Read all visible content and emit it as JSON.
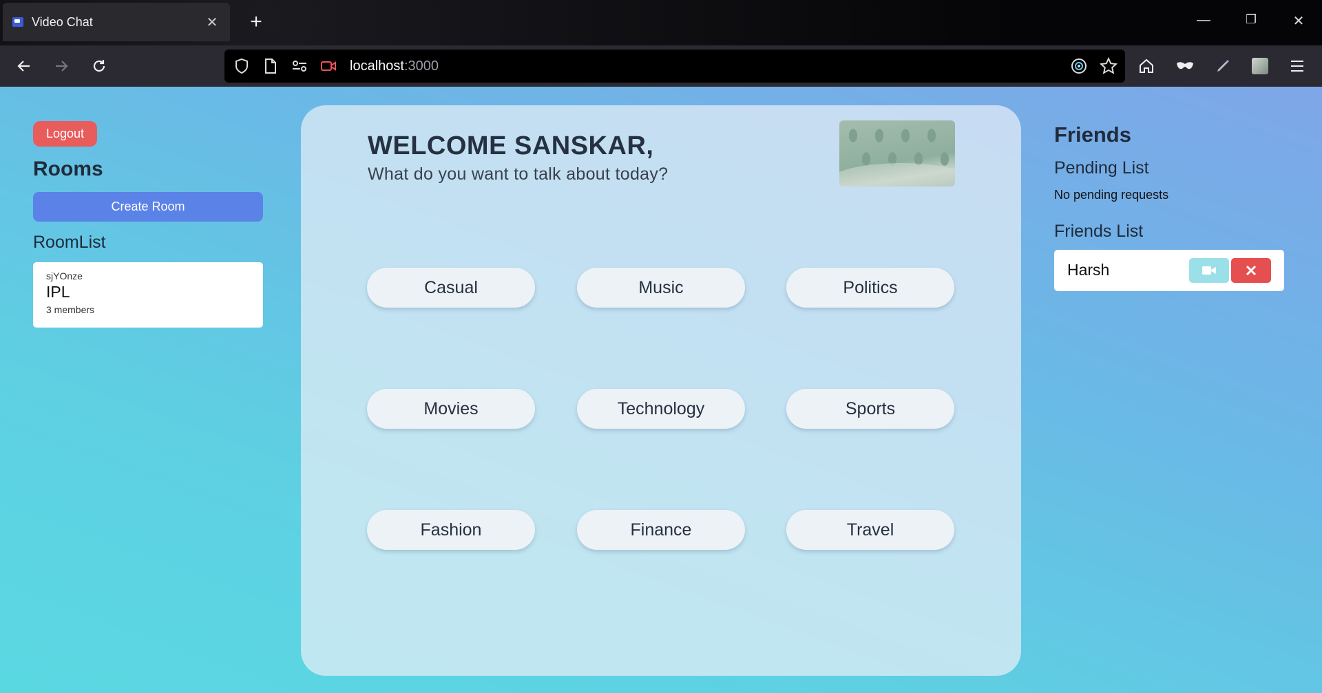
{
  "browser": {
    "tab_title": "Video Chat",
    "tab_close": "✕",
    "new_tab": "+",
    "url_host": "localhost",
    "url_port": ":3000",
    "window_controls": {
      "minimize": "—",
      "restore": "❐",
      "close": "✕"
    }
  },
  "sidebar": {
    "logout_label": "Logout",
    "rooms_heading": "Rooms",
    "create_room_label": "Create Room",
    "roomlist_heading": "RoomList",
    "rooms": [
      {
        "id": "sjYOnze",
        "name": "IPL",
        "members": "3 members"
      }
    ]
  },
  "main": {
    "welcome": "WELCOME SANSKAR,",
    "subtitle": "What do you want to talk about today?",
    "topics": [
      "Casual",
      "Music",
      "Politics",
      "Movies",
      "Technology",
      "Sports",
      "Fashion",
      "Finance",
      "Travel"
    ]
  },
  "friends": {
    "heading": "Friends",
    "pending_heading": "Pending List",
    "pending_empty": "No pending requests",
    "list_heading": "Friends List",
    "list": [
      {
        "name": "Harsh"
      }
    ]
  },
  "colors": {
    "logout": "#e95c5c",
    "create_room": "#5b82e6",
    "video_button": "#9bdfe8",
    "remove_button": "#e54f4f"
  }
}
